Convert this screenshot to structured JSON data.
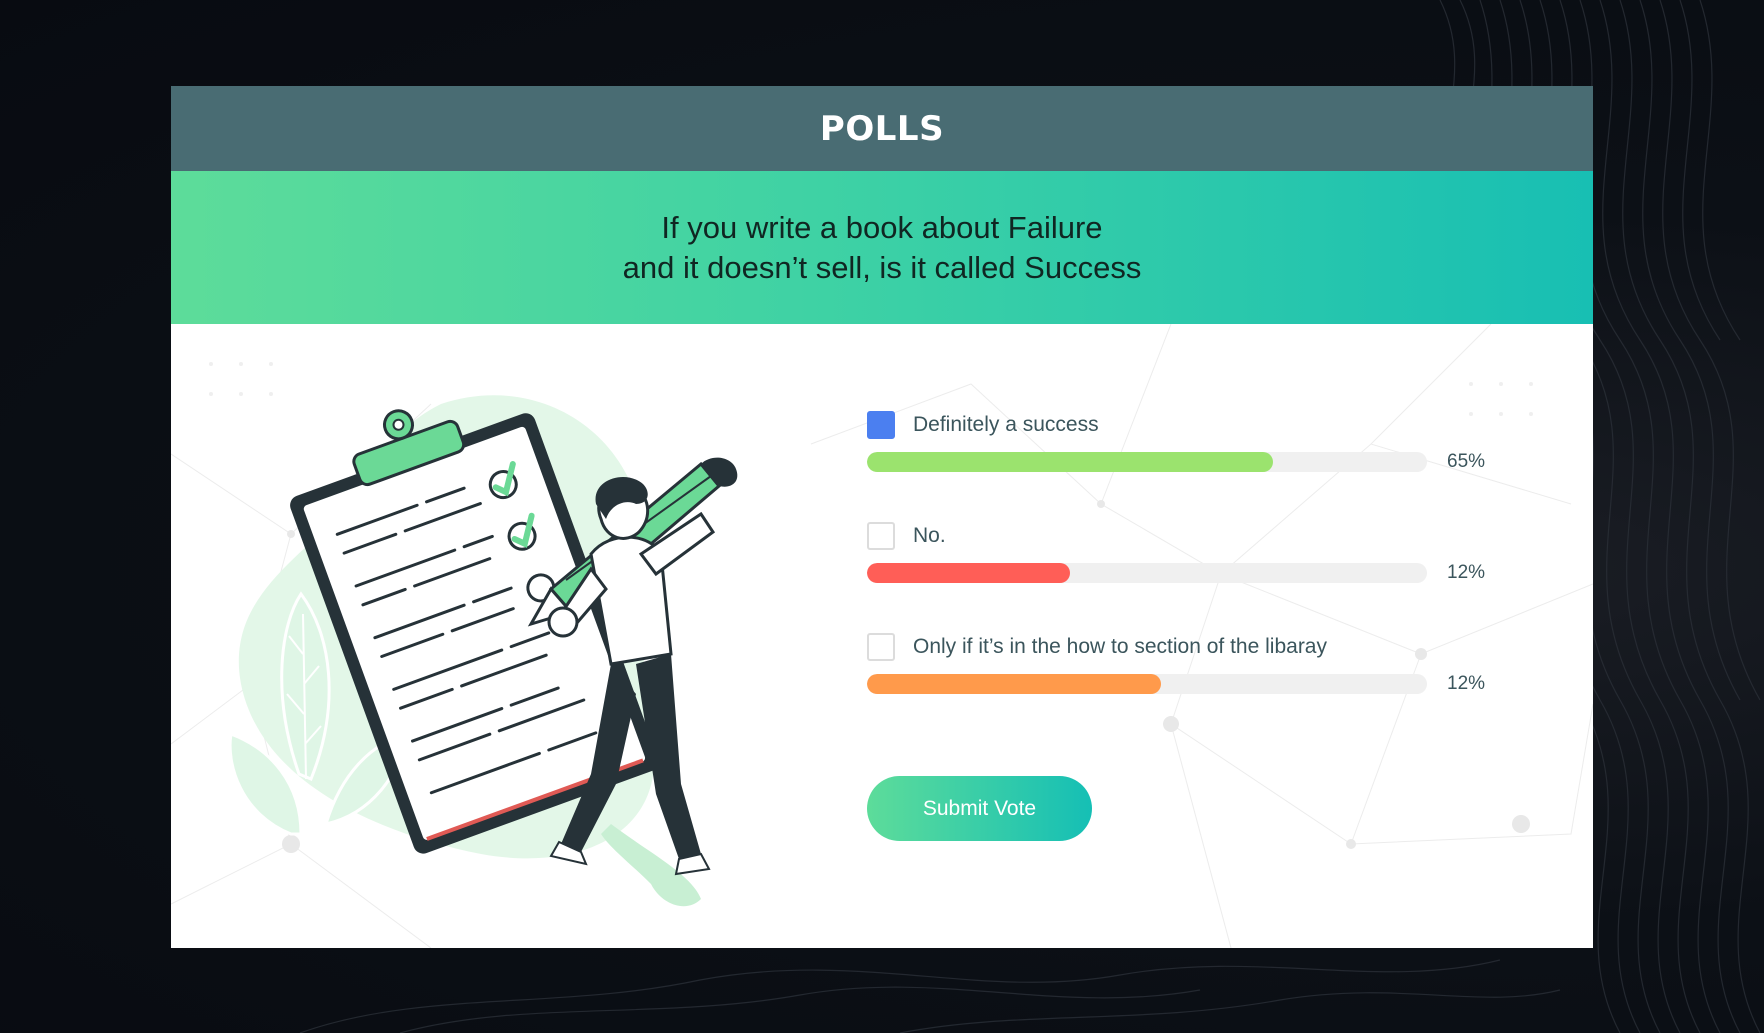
{
  "header": {
    "title": "POLLS"
  },
  "question": {
    "line1": "If you write a book about Failure",
    "line2": "and it doesn’t sell, is it called Success"
  },
  "options": [
    {
      "label": "Definitely a success",
      "percent_label": "65%",
      "fill_fraction": 0.725,
      "color": "#9be36e",
      "checked": true
    },
    {
      "label": "No.",
      "percent_label": "12%",
      "fill_fraction": 0.362,
      "color": "#ff5e57",
      "checked": false
    },
    {
      "label": "Only if it’s in the how to section of the libaray",
      "percent_label": "12%",
      "fill_fraction": 0.525,
      "color": "#ff9a4b",
      "checked": false
    }
  ],
  "submit": {
    "label": "Submit Vote"
  },
  "colors": {
    "header_bg": "#496c73",
    "band_start": "#5ddc9a",
    "band_end": "#18bfb3",
    "checkbox_checked": "#4b7ff0",
    "illustration_green": "#6bd996",
    "illustration_dark": "#263238"
  }
}
